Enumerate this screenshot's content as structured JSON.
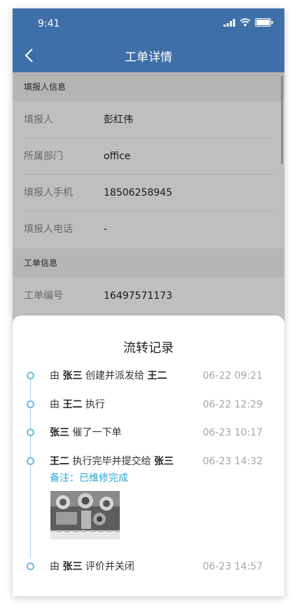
{
  "status_bar": {
    "time": "9:41"
  },
  "header": {
    "title": "工单详情"
  },
  "sections": [
    {
      "title": "填报人信息"
    },
    {
      "title": "工单信息"
    }
  ],
  "reporter_rows": [
    {
      "label": "填报人",
      "value": "彭红伟"
    },
    {
      "label": "所属部门",
      "value": "office"
    },
    {
      "label": "填报人手机",
      "value": "18506258945"
    },
    {
      "label": "填报人电话",
      "value": "-"
    }
  ],
  "order_rows": [
    {
      "label": "工单编号",
      "value": "16497571173"
    }
  ],
  "flow": {
    "title": "流转记录",
    "items": [
      {
        "parts": [
          "由 ",
          "张三",
          " 创建并派发给 ",
          "王二"
        ],
        "time": "06-22 09:21"
      },
      {
        "parts": [
          "由 ",
          "王二",
          " 执行"
        ],
        "time": "06-22 12:29"
      },
      {
        "parts": [
          "",
          "张三",
          " 催了一下单"
        ],
        "time": "06-23 10:17"
      },
      {
        "parts": [
          "",
          "王二",
          " 执行完毕并提交给 ",
          "张三"
        ],
        "time": "06-23 14:32",
        "note": "备注：已维修完成"
      },
      {
        "parts": [
          "由 ",
          "张三",
          " 评价并关闭"
        ],
        "time": "06-23 14:57"
      }
    ]
  },
  "colors": {
    "header_bg": "#3e6fa8",
    "timeline": "#6fb9df",
    "note_text": "#2aa7d6"
  }
}
